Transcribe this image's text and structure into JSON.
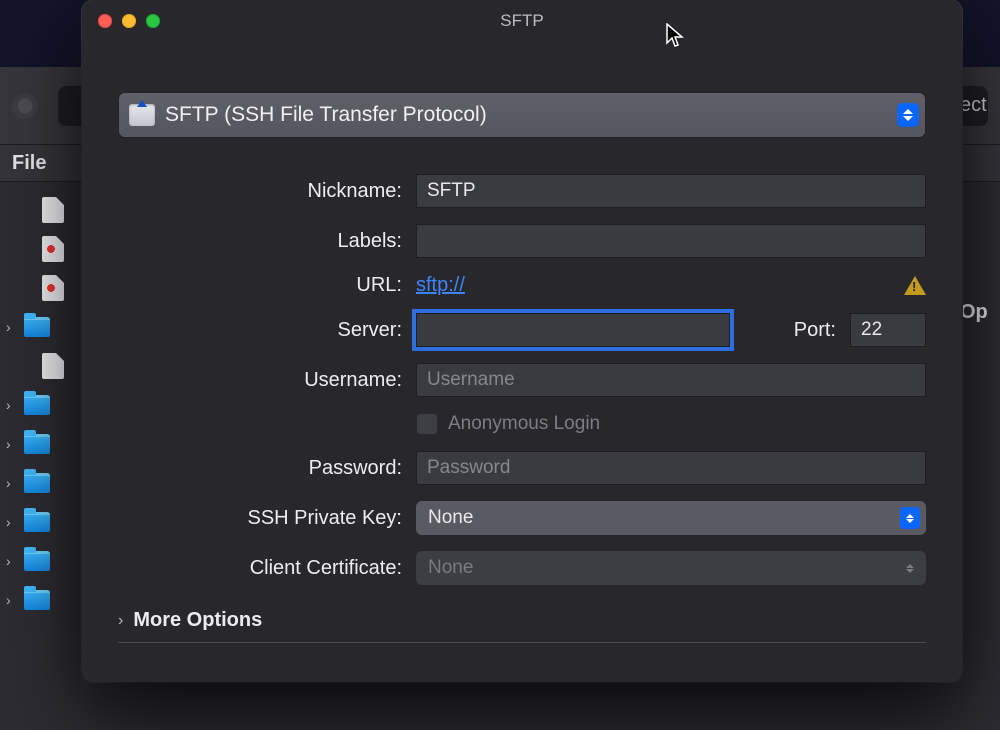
{
  "bg": {
    "col_file": "File",
    "connect_frag": "ect",
    "op_frag": "Op"
  },
  "dialog": {
    "title": "SFTP",
    "protocol": "SFTP (SSH File Transfer Protocol)",
    "labels": {
      "nickname": "Nickname:",
      "labels": "Labels:",
      "url": "URL:",
      "server": "Server:",
      "port": "Port:",
      "username": "Username:",
      "anon": "Anonymous Login",
      "password": "Password:",
      "ssh_key": "SSH Private Key:",
      "client_cert": "Client Certificate:",
      "more": "More Options"
    },
    "values": {
      "nickname": "SFTP",
      "url": "sftp://",
      "server": "",
      "port": "22",
      "username": "",
      "password": "",
      "ssh_key": "None",
      "client_cert": "None"
    },
    "placeholders": {
      "username": "Username",
      "password": "Password"
    }
  }
}
